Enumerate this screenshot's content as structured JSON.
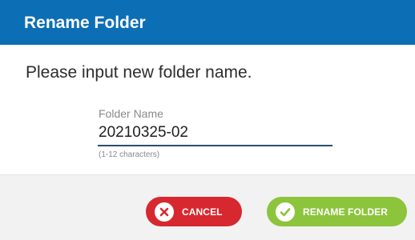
{
  "dialog": {
    "title": "Rename Folder",
    "prompt": "Please input new folder name.",
    "field": {
      "label": "Folder Name",
      "value": "20210325-02",
      "hint": "(1-12 characters)"
    },
    "buttons": {
      "cancel": {
        "label": "CANCEL",
        "icon": "close-icon",
        "color": "#d7282f"
      },
      "rename": {
        "label": "RENAME FOLDER",
        "icon": "check-icon",
        "color": "#8cc43c"
      }
    }
  },
  "colors": {
    "title_bar": "#0c6fb5",
    "footer": "#f2f2f2",
    "underline": "#2c4d6a"
  }
}
